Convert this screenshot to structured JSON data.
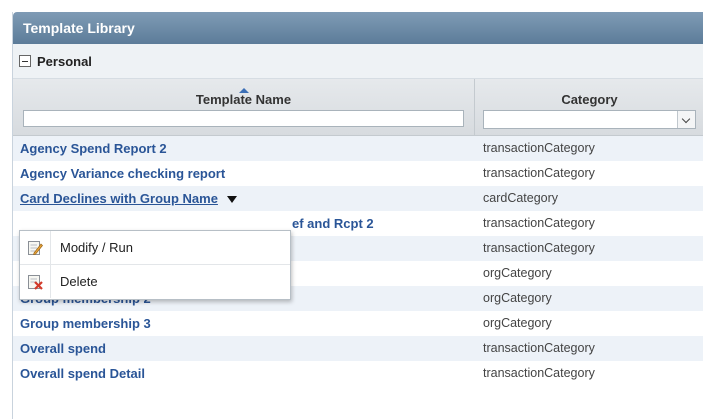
{
  "panel": {
    "title": "Template Library"
  },
  "group": {
    "label": "Personal"
  },
  "columns": {
    "name": "Template Name",
    "category": "Category"
  },
  "filters": {
    "name_value": "",
    "category_value": ""
  },
  "rows": [
    {
      "name": "Agency Spend Report 2",
      "category": "transactionCategory"
    },
    {
      "name": "Agency Variance checking report",
      "category": "transactionCategory"
    },
    {
      "name": "Card Declines with Group Name",
      "category": "cardCategory"
    },
    {
      "name": "ef and Rcpt 2",
      "category": "transactionCategory"
    },
    {
      "name": "",
      "category": "transactionCategory"
    },
    {
      "name": "",
      "category": "orgCategory"
    },
    {
      "name": "Group membership 2",
      "category": "orgCategory"
    },
    {
      "name": "Group membership 3",
      "category": "orgCategory"
    },
    {
      "name": "Overall spend",
      "category": "transactionCategory"
    },
    {
      "name": "Overall spend Detail",
      "category": "transactionCategory"
    }
  ],
  "context_menu": {
    "items": [
      {
        "label": "Modify / Run",
        "icon": "edit-icon"
      },
      {
        "label": "Delete",
        "icon": "delete-icon"
      }
    ]
  },
  "colors": {
    "title_bar": "#6b89a6",
    "link": "#2a5597",
    "row_alt": "#edf2f8"
  }
}
